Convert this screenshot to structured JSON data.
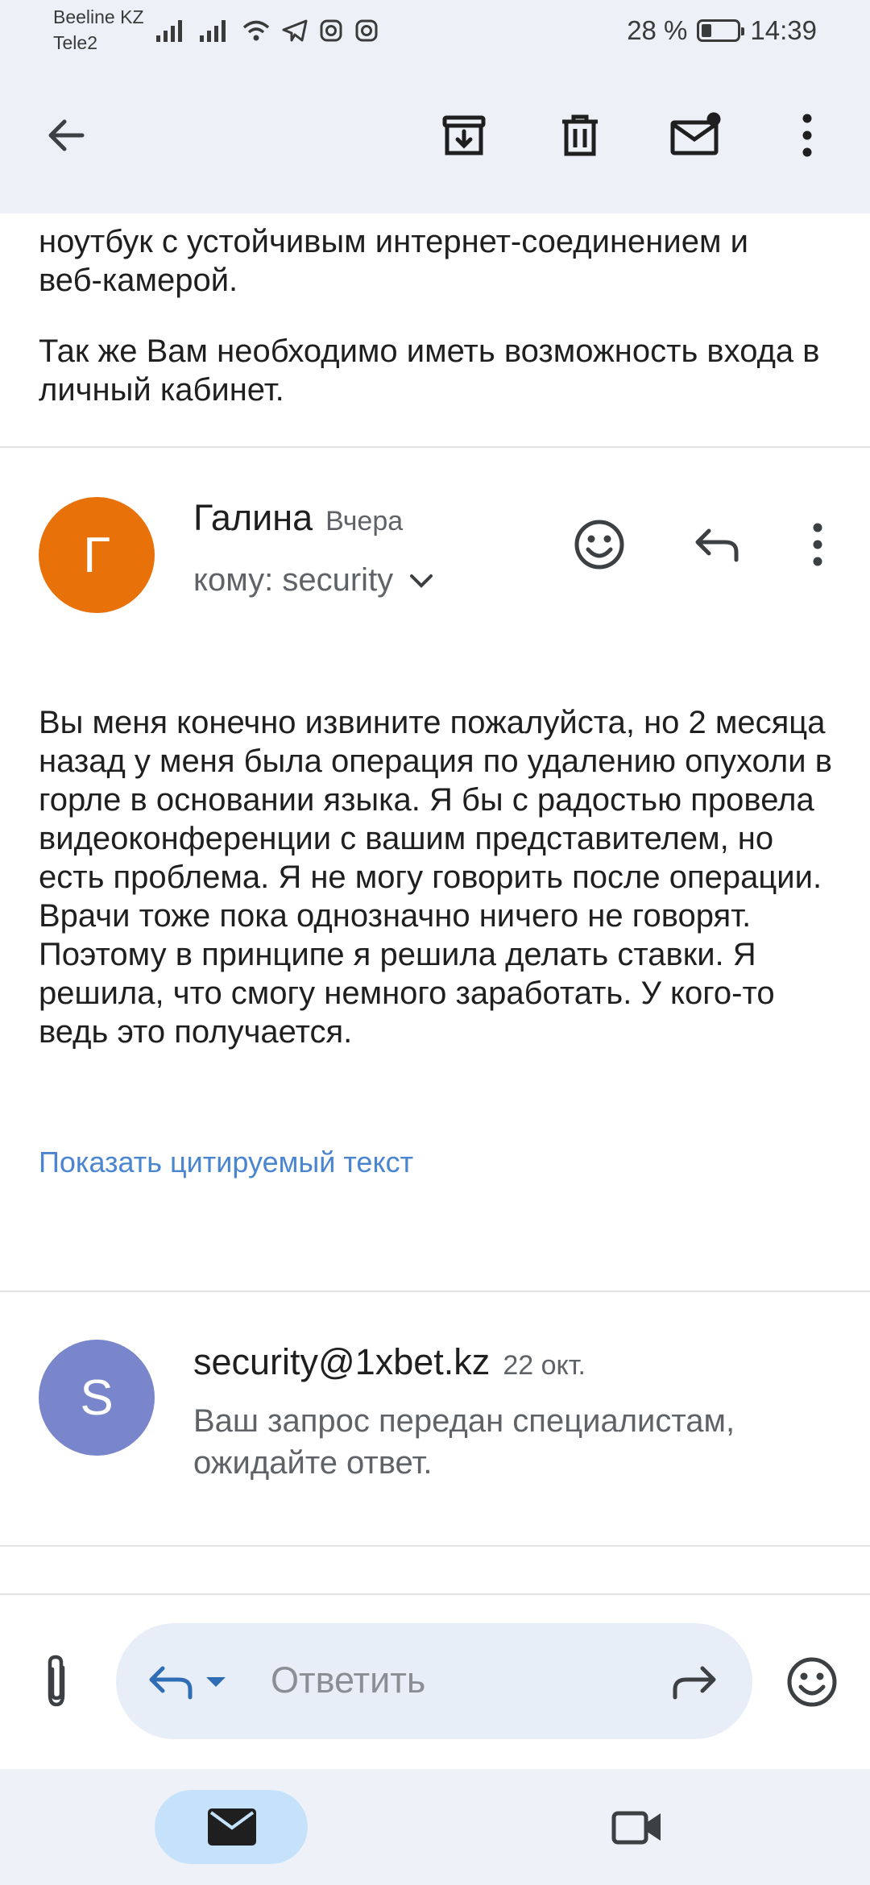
{
  "status_bar": {
    "carrier1": "Beeline KZ",
    "carrier2": "Tele2",
    "battery_text": "28 %",
    "battery_level": 0.28,
    "time": "14:39"
  },
  "toolbar": {
    "back_icon": "arrow-left-icon",
    "archive_icon": "archive-icon",
    "delete_icon": "trash-icon",
    "mark_unread_icon": "mail-unread-icon",
    "more_icon": "more-vertical-icon"
  },
  "prev_message": {
    "line_partial": "ноутбук с устойчивым интернет-соединением и",
    "line_partial2": "веб-камерой.",
    "para2": "Так же Вам необходимо иметь возможность входа в личный кабинет."
  },
  "message1": {
    "avatar_letter": "Г",
    "avatar_color": "#e8710a",
    "sender": "Галина",
    "date": "Вчера",
    "recipient": "кому: security",
    "body": "Вы меня конечно извините пожалуйста, но 2 месяца назад у меня была операция по удалению опухоли в горле в основании языка. Я бы с радостью провела видеоконференции с вашим представителем, но есть проблема. Я не могу говорить после операции. Врачи тоже пока однозначно ничего не говорят. Поэтому в принципе я решила делать ставки. Я решила, что смогу немного заработать. У кого-то ведь это получается.",
    "show_quoted": "Показать цитируемый текст"
  },
  "message2": {
    "avatar_letter": "S",
    "avatar_color": "#7986cb",
    "sender": "security@1xbet.kz",
    "date": "22 окт.",
    "snippet": "Ваш запрос передан специалистам, ожидайте ответ."
  },
  "reply_bar": {
    "placeholder": "Ответить"
  },
  "colors": {
    "accent_blue": "#4a85d0",
    "nav_active": "#c6e2fb"
  }
}
